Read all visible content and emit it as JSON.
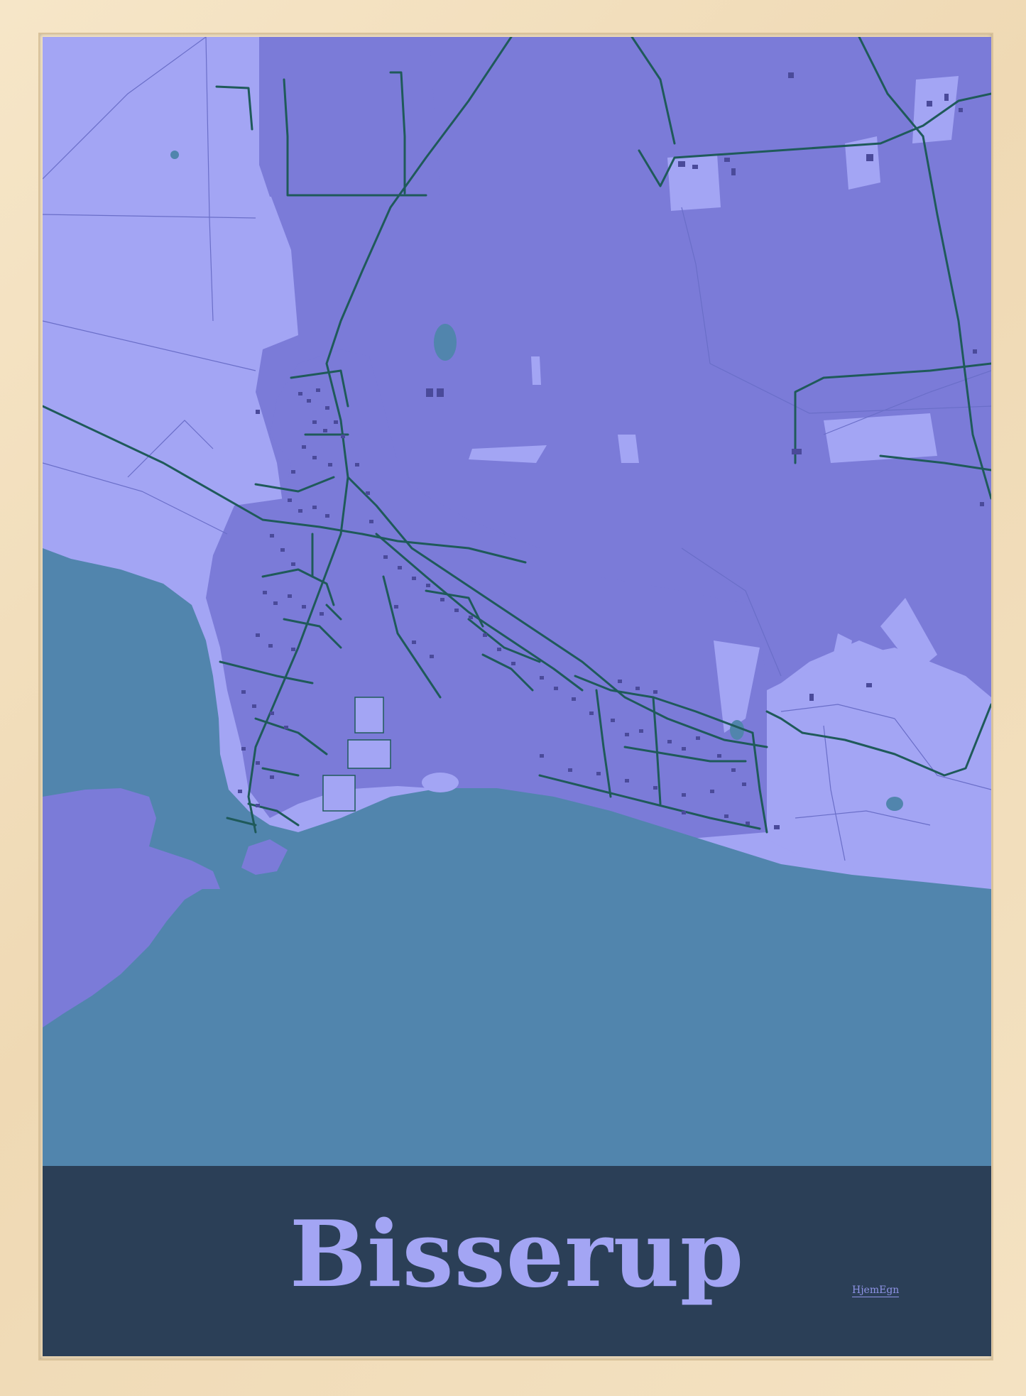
{
  "poster": {
    "city_name": "Bisserup",
    "brand": "HjemEgn"
  },
  "colors": {
    "frame": "#f2dfbf",
    "land_light": "#a3a5f4",
    "land_dark": "#7b7bd8",
    "water": "#5185ad",
    "roads": "#1f5a5a",
    "buildings": "#4a4a9a",
    "title_band": "#2b3f57",
    "title_text": "#a3a5f4"
  }
}
